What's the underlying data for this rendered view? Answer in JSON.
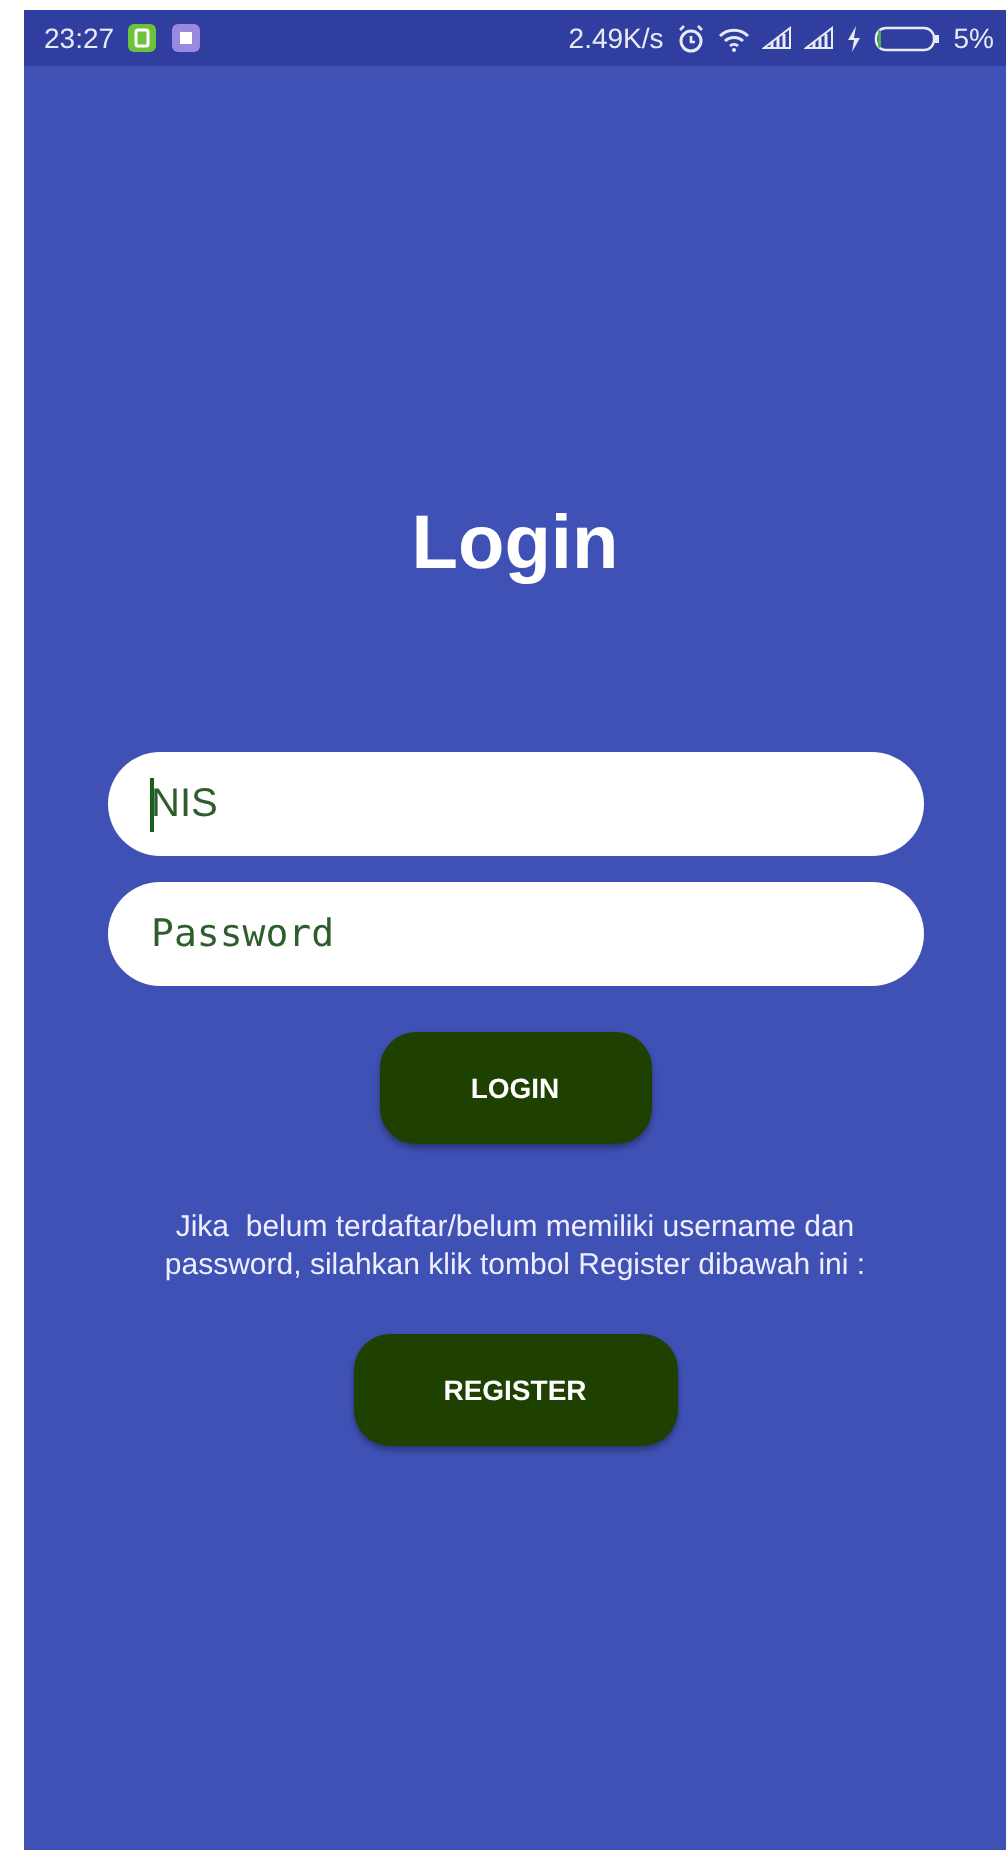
{
  "status_bar": {
    "time": "23:27",
    "speed": "2.49K/s",
    "battery": {
      "percent": "5%",
      "level": 0.05
    }
  },
  "title": "Login",
  "fields": [
    {
      "placeholder": "NIS",
      "kind": "text",
      "focused": true
    },
    {
      "placeholder": "Password",
      "kind": "password",
      "focused": false
    }
  ],
  "login_button": "LOGIN",
  "hint": "Jika  belum terdaftar/belum memiliki username dan password, silahkan klik tombol Register dibawah ini :",
  "register_button": "REGISTER"
}
